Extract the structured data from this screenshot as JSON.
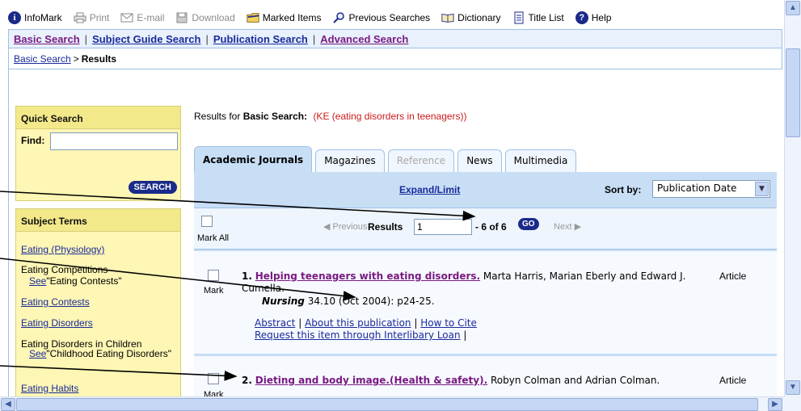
{
  "toolbar": {
    "items": [
      {
        "label": "InfoMark",
        "icon": "info-icon"
      },
      {
        "label": "Print",
        "icon": "printer-icon"
      },
      {
        "label": "E-mail",
        "icon": "envelope-icon"
      },
      {
        "label": "Download",
        "icon": "disk-icon"
      },
      {
        "label": "Marked Items",
        "icon": "folder-icon"
      },
      {
        "label": "Previous Searches",
        "icon": "magnifier-icon"
      },
      {
        "label": "Dictionary",
        "icon": "book-icon"
      },
      {
        "label": "Title List",
        "icon": "list-icon"
      },
      {
        "label": "Help",
        "icon": "help-icon"
      }
    ]
  },
  "nav": {
    "basic_search": "Basic Search",
    "subject_guide": "Subject Guide Search",
    "publication": "Publication Search",
    "advanced": "Advanced Search",
    "separator": "|"
  },
  "breadcrumb": {
    "link": "Basic Search",
    "arrow": ">",
    "current": "Results"
  },
  "quick_search": {
    "title": "Quick Search",
    "find_label": "Find:",
    "find_value": "",
    "button": "SEARCH"
  },
  "subject_terms": {
    "title": "Subject Terms",
    "items": [
      {
        "term": "Eating (Physiology)",
        "link": true
      },
      {
        "term": "Eating Competitions",
        "link": false,
        "see_label": "See",
        "see_target": "\"Eating Contests\""
      },
      {
        "term": "Eating Contests",
        "link": true
      },
      {
        "term": "Eating Disorders",
        "link": true
      },
      {
        "term": "Eating Disorders in Children",
        "link": false,
        "see_label": "See",
        "see_target": "\"Childhood Eating Disorders\""
      },
      {
        "term": "Eating Habits",
        "link": true
      }
    ]
  },
  "results_for": {
    "prefix": "Results for",
    "type": "Basic Search:",
    "query": "(KE (eating disorders in teenagers))"
  },
  "tabs": [
    {
      "label": "Academic Journals",
      "state": "active"
    },
    {
      "label": "Magazines",
      "state": "normal"
    },
    {
      "label": "Reference",
      "state": "disabled"
    },
    {
      "label": "News",
      "state": "normal"
    },
    {
      "label": "Multimedia",
      "state": "normal"
    }
  ],
  "panel": {
    "expand_limit": "Expand/Limit",
    "sort_label": "Sort by:",
    "sort_value": "Publication Date"
  },
  "results_bar": {
    "mark_all": "Mark All",
    "previous": "◀ Previous",
    "results_label": "Results",
    "results_input": "1",
    "range_text": "- 6 of 6",
    "go": "GO",
    "next": "Next ▶"
  },
  "records": [
    {
      "number": "1.",
      "title": "Helping teenagers with eating disorders.",
      "authors": " Marta Harris, Marian Eberly and Edward J. Cumella.",
      "doctype": "Article",
      "mark": "Mark",
      "source_title": "Nursing",
      "source_rest": " 34.10 (Oct 2004): p24-25.",
      "link_abstract": "Abstract",
      "link_about": "About this publication",
      "link_cite": "How to Cite",
      "link_ill": "Request this item through Interlibary Loan",
      "sep": "|"
    },
    {
      "number": "2.",
      "title": "Dieting and body image.(Health & safety).",
      "authors": " Robyn Colman and Adrian Colman.",
      "doctype": "Article",
      "mark": "Mark"
    }
  ]
}
